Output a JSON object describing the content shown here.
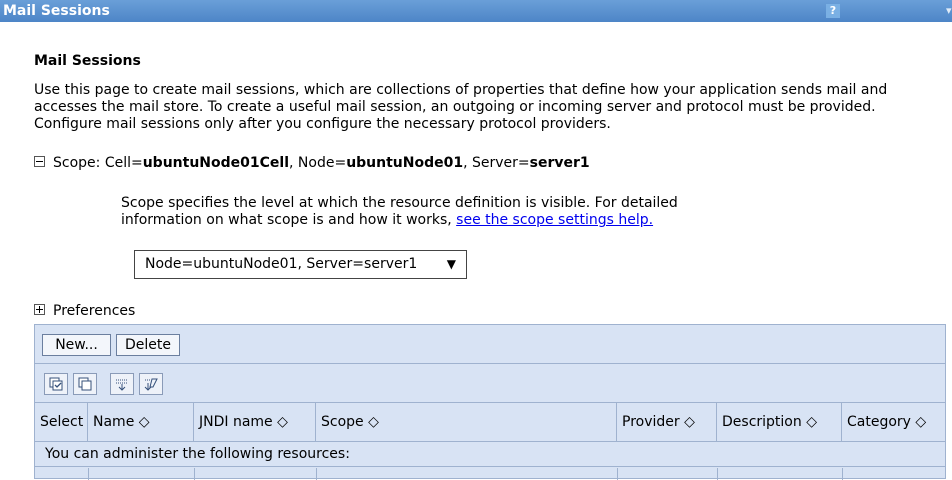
{
  "window": {
    "title": "Mail Sessions",
    "help_label": "?"
  },
  "page": {
    "heading": "Mail Sessions",
    "description": "Use this page to create mail sessions, which are collections of properties that define how your application sends mail and accesses the mail store. To create a useful mail session, an outgoing or incoming server and protocol must be provided. Configure mail sessions only after you configure the necessary protocol providers."
  },
  "scope": {
    "prefix": "Scope: Cell=",
    "cell": "ubuntuNode01Cell",
    "node_label": ", Node=",
    "node": "ubuntuNode01",
    "server_label": ", Server=",
    "server": "server1",
    "help_text": "Scope specifies the level at which the resource definition is visible. For detailed information on what scope is and how it works, ",
    "help_link": "see the scope settings help.",
    "selected": "Node=ubuntuNode01, Server=server1"
  },
  "preferences": {
    "label": "Preferences"
  },
  "toolbar": {
    "new_label": "New...",
    "delete_label": "Delete"
  },
  "table": {
    "columns": [
      "Select",
      "Name",
      "JNDI name",
      "Scope",
      "Provider",
      "Description",
      "Category"
    ],
    "sort_glyph": "◇",
    "notice": "You can administer the following resources:"
  }
}
